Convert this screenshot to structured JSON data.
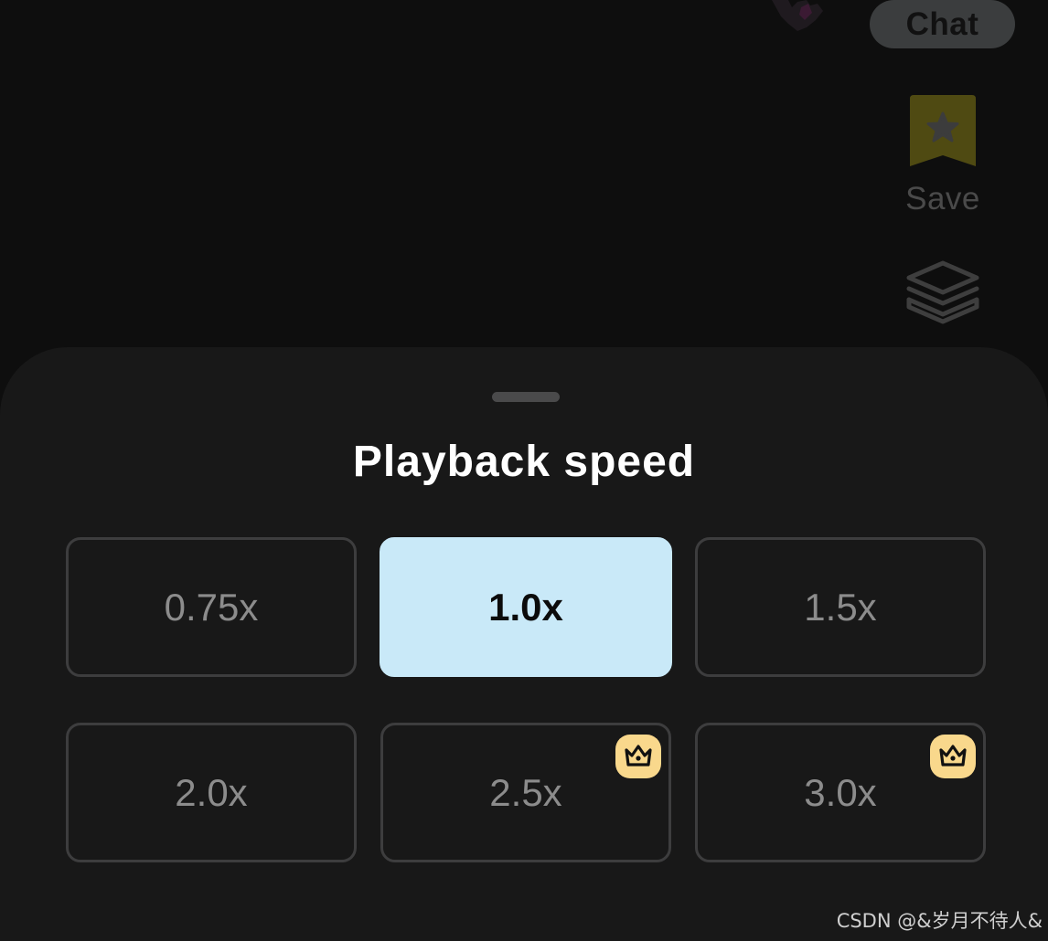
{
  "header": {
    "chat_label": "Chat",
    "save_label": "Save"
  },
  "icons": {
    "save": "bookmark-star-icon",
    "layers": "layers-icon",
    "premium": "crown-icon"
  },
  "sheet": {
    "title": "Playback speed",
    "options": [
      {
        "label": "0.75x",
        "selected": false,
        "premium": false
      },
      {
        "label": "1.0x",
        "selected": true,
        "premium": false
      },
      {
        "label": "1.5x",
        "selected": false,
        "premium": false
      },
      {
        "label": "2.0x",
        "selected": false,
        "premium": false
      },
      {
        "label": "2.5x",
        "selected": false,
        "premium": true
      },
      {
        "label": "3.0x",
        "selected": false,
        "premium": true
      }
    ]
  },
  "watermark": "CSDN @&岁月不待人&",
  "colors": {
    "selected_bg": "#c9e9f8",
    "premium_badge": "#f9d88c",
    "save_icon": "#4f4a12",
    "sheet_bg": "#181818"
  }
}
